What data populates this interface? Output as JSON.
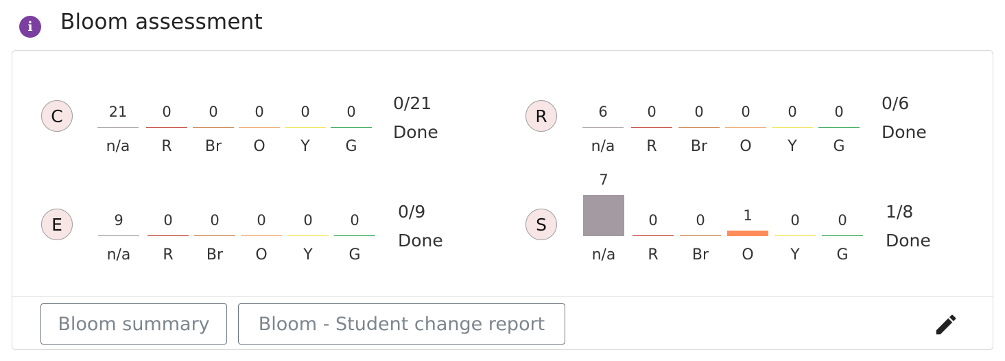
{
  "header": {
    "title": "Bloom assessment",
    "info_icon": "i"
  },
  "colors": {
    "na": "#a39aa2",
    "R": "#c0392b",
    "Br": "#c8783c",
    "O": "#f0a060",
    "Y": "#f2e24a",
    "G": "#27a24a",
    "O_filled": "#ff8c5a",
    "badge_bg": "#f8e6e6",
    "info_icon_bg": "#7b3fa0"
  },
  "groups": [
    {
      "badge": "C",
      "columns": [
        {
          "label": "n/a",
          "count": "21",
          "level": 0,
          "color": "#a39aa2"
        },
        {
          "label": "R",
          "count": "0",
          "level": 0,
          "color": "#c0392b"
        },
        {
          "label": "Br",
          "count": "0",
          "level": 0,
          "color": "#c8783c"
        },
        {
          "label": "O",
          "count": "0",
          "level": 0,
          "color": "#f0a060"
        },
        {
          "label": "Y",
          "count": "0",
          "level": 0,
          "color": "#f2e24a"
        },
        {
          "label": "G",
          "count": "0",
          "level": 0,
          "color": "#27a24a"
        }
      ],
      "progress": "0/21",
      "status": "Done"
    },
    {
      "badge": "R",
      "columns": [
        {
          "label": "n/a",
          "count": "6",
          "level": 0,
          "color": "#a39aa2"
        },
        {
          "label": "R",
          "count": "0",
          "level": 0,
          "color": "#c0392b"
        },
        {
          "label": "Br",
          "count": "0",
          "level": 0,
          "color": "#c8783c"
        },
        {
          "label": "O",
          "count": "0",
          "level": 0,
          "color": "#f0a060"
        },
        {
          "label": "Y",
          "count": "0",
          "level": 0,
          "color": "#f2e24a"
        },
        {
          "label": "G",
          "count": "0",
          "level": 0,
          "color": "#27a24a"
        }
      ],
      "progress": "0/6",
      "status": "Done"
    },
    {
      "badge": "E",
      "columns": [
        {
          "label": "n/a",
          "count": "9",
          "level": 0,
          "color": "#a39aa2"
        },
        {
          "label": "R",
          "count": "0",
          "level": 0,
          "color": "#c0392b"
        },
        {
          "label": "Br",
          "count": "0",
          "level": 0,
          "color": "#c8783c"
        },
        {
          "label": "O",
          "count": "0",
          "level": 0,
          "color": "#f0a060"
        },
        {
          "label": "Y",
          "count": "0",
          "level": 0,
          "color": "#f2e24a"
        },
        {
          "label": "G",
          "count": "0",
          "level": 0,
          "color": "#27a24a"
        }
      ],
      "progress": "0/9",
      "status": "Done"
    },
    {
      "badge": "S",
      "columns": [
        {
          "label": "n/a",
          "count": "7",
          "level": 1,
          "color": "#a39aa2"
        },
        {
          "label": "R",
          "count": "0",
          "level": 0,
          "color": "#c0392b"
        },
        {
          "label": "Br",
          "count": "0",
          "level": 0,
          "color": "#c8783c"
        },
        {
          "label": "O",
          "count": "1",
          "level": 0.14,
          "color": "#ff8c5a"
        },
        {
          "label": "Y",
          "count": "0",
          "level": 0,
          "color": "#f2e24a"
        },
        {
          "label": "G",
          "count": "0",
          "level": 0,
          "color": "#27a24a"
        }
      ],
      "progress": "1/8",
      "status": "Done"
    }
  ],
  "footer": {
    "summary_button": "Bloom summary",
    "report_button": "Bloom - Student change report",
    "edit_icon": "pencil-icon"
  }
}
